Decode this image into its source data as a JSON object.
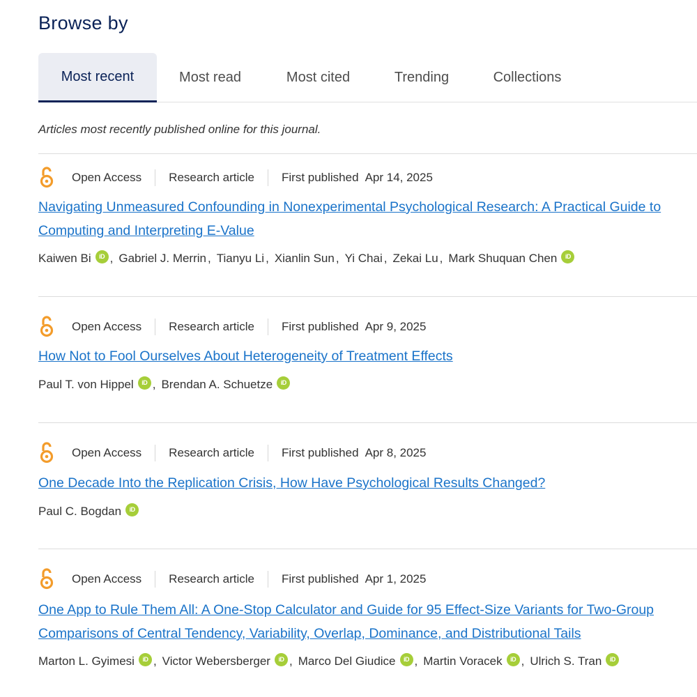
{
  "browse": {
    "heading": "Browse by"
  },
  "tabs": [
    {
      "label": "Most recent"
    },
    {
      "label": "Most read"
    },
    {
      "label": "Most cited"
    },
    {
      "label": "Trending"
    },
    {
      "label": "Collections"
    }
  ],
  "intro": "Articles most recently published online for this journal.",
  "colors": {
    "brand_navy": "#0a2257",
    "link": "#1a73c9",
    "open_access": "#f39c2b",
    "orcid": "#a6ce39"
  },
  "articles": [
    {
      "access": "Open Access",
      "type": "Research article",
      "published_label": "First published",
      "date": "Apr 14, 2025",
      "title_lines": [
        "Navigating Unmeasured Confounding in Nonexperimental Psychological Research: A Practical Guide to",
        "Computing and Interpreting E-Value"
      ],
      "authors": [
        "Kaiwen Bi",
        "Gabriel J. Merrin",
        "Tianyu Li",
        "Xianlin Sun",
        "Yi Chai",
        "Zekai Lu",
        "Mark Shuquan Chen"
      ]
    },
    {
      "access": "Open Access",
      "type": "Research article",
      "published_label": "First published",
      "date": "Apr 9, 2025",
      "title_lines": [
        "How Not to Fool Ourselves About Heterogeneity of Treatment Effects"
      ],
      "authors": [
        "Paul T. von Hippel",
        "Brendan A. Schuetze"
      ]
    },
    {
      "access": "Open Access",
      "type": "Research article",
      "published_label": "First published",
      "date": "Apr 8, 2025",
      "title_lines": [
        "One Decade Into the Replication Crisis, How Have Psychological Results Changed?"
      ],
      "authors": [
        "Paul C. Bogdan"
      ]
    },
    {
      "access": "Open Access",
      "type": "Research article",
      "published_label": "First published",
      "date": "Apr 1, 2025",
      "title_lines": [
        "One App to Rule Them All: A One-Stop Calculator and Guide for 95 Effect-Size Variants for Two-Group",
        "Comparisons of Central Tendency, Variability, Overlap, Dominance, and Distributional Tails"
      ],
      "authors": [
        "Marton L. Gyimesi",
        "Victor Webersberger",
        "Marco Del Giudice",
        "Martin Voracek",
        "Ulrich S. Tran"
      ]
    }
  ]
}
